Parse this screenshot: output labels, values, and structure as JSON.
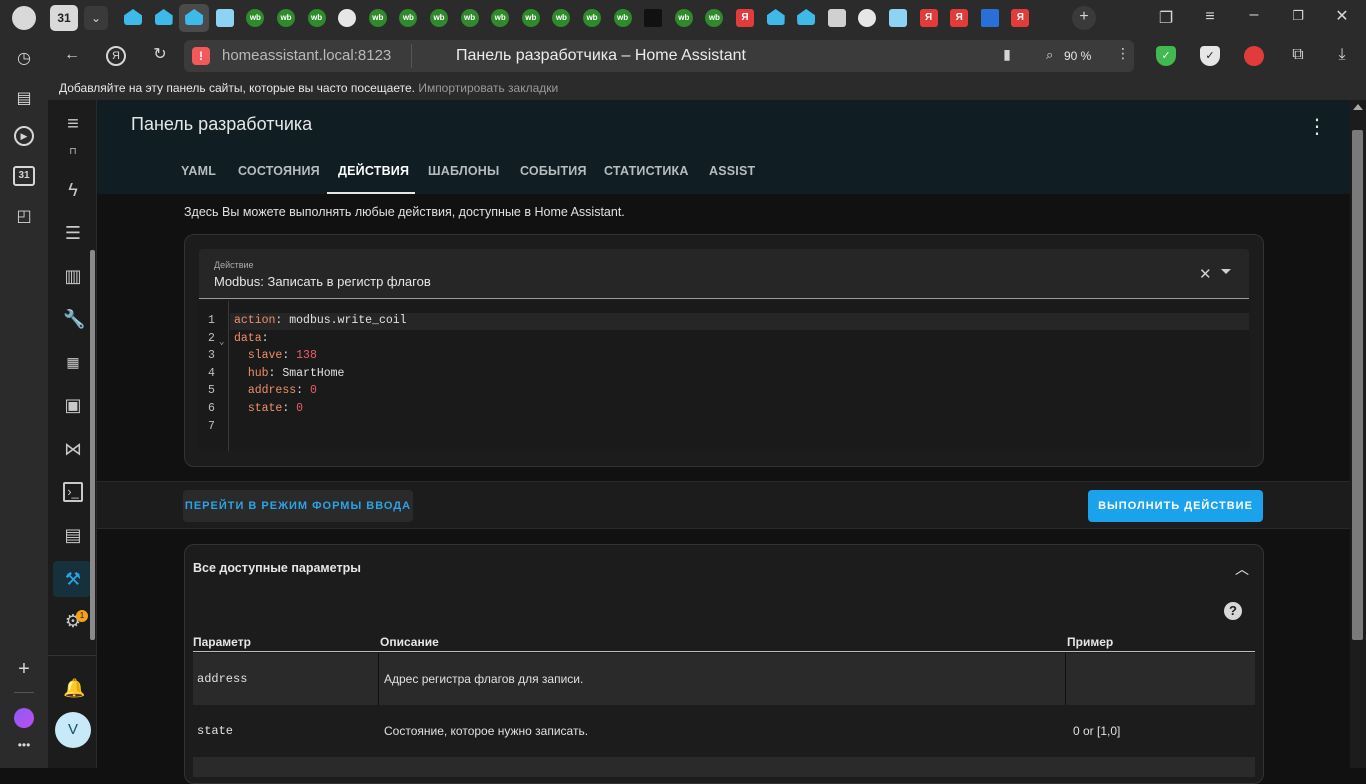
{
  "browser": {
    "tab_count_badge": "31",
    "url": "homeassistant.local:8123",
    "page_title": "Панель разработчика – Home Assistant",
    "zoom": "90 %",
    "bookmarks_prompt": "Добавляйте на эту панель сайты, которые вы часто посещаете.",
    "bookmarks_import": "Импортировать закладки",
    "tab_icons": [
      "ha",
      "ha",
      "ha-active",
      "tile",
      "wb",
      "wb",
      "wb",
      "github",
      "wb",
      "wb",
      "wb",
      "wb",
      "wb",
      "wb",
      "wb",
      "wb",
      "wb",
      "lowercase-l",
      "wb",
      "wb",
      "ya",
      "ha",
      "ha",
      "bird",
      "clock",
      "tile",
      "ya",
      "ya",
      "y-blue",
      "ya"
    ],
    "left_rail_badge": "31",
    "user_initial": "V"
  },
  "ha": {
    "header_title": "Панель разработчика",
    "tabs": [
      {
        "label": "YAML"
      },
      {
        "label": "СОСТОЯНИЯ"
      },
      {
        "label": "ДЕЙСТВИЯ"
      },
      {
        "label": "ШАБЛОНЫ"
      },
      {
        "label": "СОБЫТИЯ"
      },
      {
        "label": "СТАТИСТИКА"
      },
      {
        "label": "ASSIST"
      }
    ],
    "active_tab": "ДЕЙСТВИЯ",
    "intro": "Здесь Вы можете выполнять любые действия, доступные в Home Assistant.",
    "action_label": "Действие",
    "action_value": "Modbus: Записать в регистр флагов",
    "code_lines": [
      {
        "n": "1",
        "key": "action",
        "sep": ": ",
        "val": "modbus.write_coil",
        "indent": "",
        "num": false
      },
      {
        "n": "2",
        "key": "data",
        "sep": ":",
        "val": "",
        "indent": "",
        "num": false
      },
      {
        "n": "3",
        "key": "slave",
        "sep": ": ",
        "val": "138",
        "indent": "  ",
        "num": true
      },
      {
        "n": "4",
        "key": "hub",
        "sep": ": ",
        "val": "SmartHome",
        "indent": "  ",
        "num": false
      },
      {
        "n": "5",
        "key": "address",
        "sep": ": ",
        "val": "0",
        "indent": "  ",
        "num": true
      },
      {
        "n": "6",
        "key": "state",
        "sep": ": ",
        "val": "0",
        "indent": "  ",
        "num": true
      },
      {
        "n": "7",
        "key": "",
        "sep": "",
        "val": "",
        "indent": "",
        "num": false
      }
    ],
    "yaml_mode_button": "ПЕРЕЙТИ В РЕЖИМ ФОРМЫ ВВОДА",
    "run_button": "ВЫПОЛНИТЬ ДЕЙСТВИЕ",
    "params_title": "Все доступные параметры",
    "table": {
      "headers": [
        "Параметр",
        "Описание",
        "Пример"
      ],
      "rows": [
        {
          "param": "address",
          "desc": "Адрес регистра флагов для записи.",
          "example": ""
        },
        {
          "param": "state",
          "desc": "Состояние, которое нужно записать.",
          "example": "0 or [1,0]"
        }
      ]
    },
    "settings_badge": "1"
  }
}
